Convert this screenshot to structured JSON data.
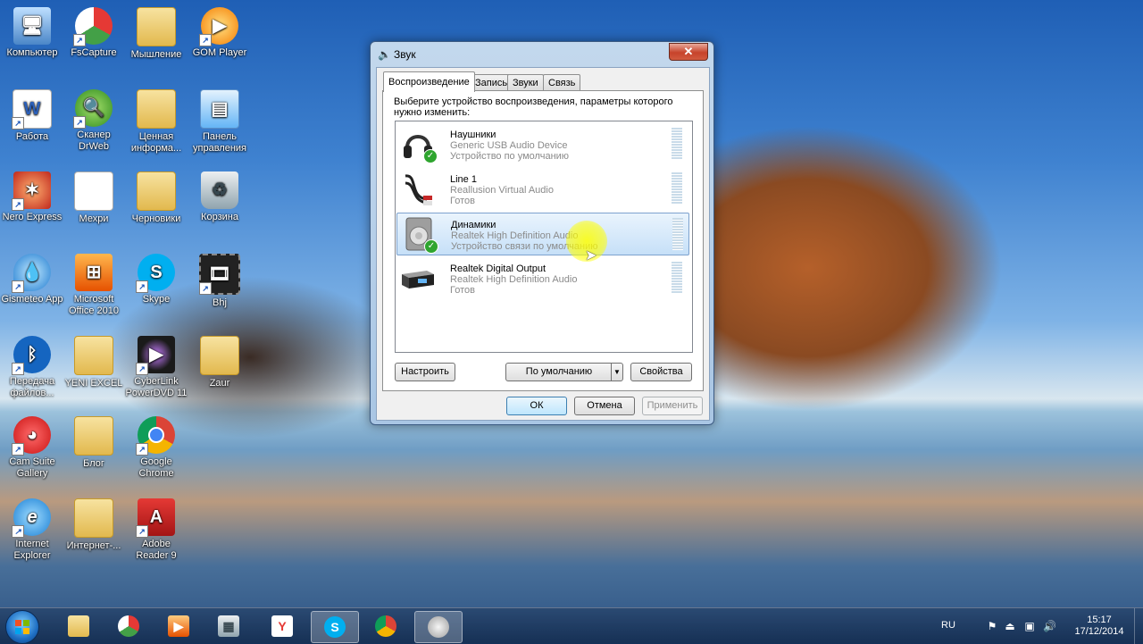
{
  "desktop": {
    "icons": [
      {
        "label": "Компьютер"
      },
      {
        "label": "FsCapture"
      },
      {
        "label": "Мышление"
      },
      {
        "label": "GOM Player"
      },
      {
        "label": "Работа"
      },
      {
        "label": "Сканер DrWeb"
      },
      {
        "label": "Ценная информа..."
      },
      {
        "label": "Панель управления"
      },
      {
        "label": "Nero Express"
      },
      {
        "label": "Мехри"
      },
      {
        "label": "Черновики"
      },
      {
        "label": "Корзина"
      },
      {
        "label": "Gismeteo App"
      },
      {
        "label": "Microsoft Office 2010"
      },
      {
        "label": "Skype"
      },
      {
        "label": "Bhj"
      },
      {
        "label": "Передача файлов..."
      },
      {
        "label": "YENI EXCEL"
      },
      {
        "label": "CyberLink PowerDVD 11"
      },
      {
        "label": "Zaur"
      },
      {
        "label": "Cam Suite Gallery"
      },
      {
        "label": "Блог"
      },
      {
        "label": "Google Chrome"
      },
      {
        "label": "Internet Explorer"
      },
      {
        "label": "Интернет-..."
      },
      {
        "label": "Adobe Reader 9"
      }
    ]
  },
  "dialog": {
    "title": "Звук",
    "close_glyph": "✕",
    "tabs": [
      {
        "label": "Воспроизведение"
      },
      {
        "label": "Запись"
      },
      {
        "label": "Звуки"
      },
      {
        "label": "Связь"
      }
    ],
    "instruction": "Выберите устройство воспроизведения, параметры которого нужно изменить:",
    "devices": [
      {
        "name": "Наушники",
        "description": "Generic USB Audio Device",
        "status": "Устройство по умолчанию"
      },
      {
        "name": "Line 1",
        "description": "Reallusion Virtual Audio",
        "status": "Готов"
      },
      {
        "name": "Динамики",
        "description": "Realtek High Definition Audio",
        "status": "Устройство связи по умолчанию"
      },
      {
        "name": "Realtek Digital Output",
        "description": "Realtek High Definition Audio",
        "status": "Готов"
      }
    ],
    "buttons": {
      "configure": "Настроить",
      "set_default": "По умолчанию",
      "properties": "Свойства",
      "ok": "ОК",
      "cancel": "Отмена",
      "apply": "Применить"
    }
  },
  "taskbar": {
    "items": [
      {
        "icon": "explorer-folder-icon"
      },
      {
        "icon": "fscapture-icon"
      },
      {
        "icon": "media-player-icon"
      },
      {
        "icon": "calculator-icon"
      },
      {
        "icon": "yandex-icon",
        "glyph": "Y"
      },
      {
        "icon": "skype-icon",
        "glyph": "S"
      },
      {
        "icon": "chrome-icon"
      },
      {
        "icon": "sound-icon"
      }
    ],
    "language": "RU",
    "time": "15:17",
    "date": "17/12/2014"
  }
}
